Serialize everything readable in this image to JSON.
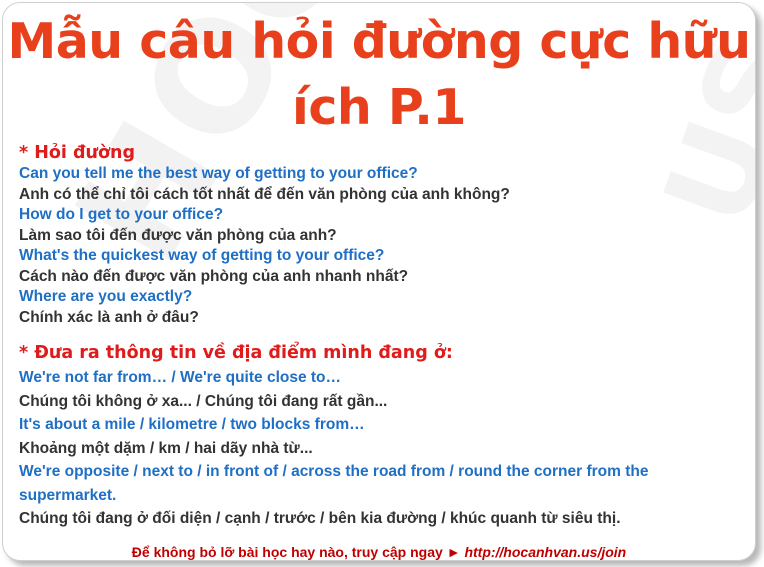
{
  "title": "Mẫu câu hỏi đường cực hữu ích P.1",
  "section1": {
    "heading": "* Hỏi đường",
    "lines": [
      {
        "en": "Can you tell me the best way of getting to your office?",
        "vi": "Anh có thể chỉ tôi cách tốt nhất để đến văn phòng của anh không?"
      },
      {
        "en": "How do I get to your office?",
        "vi": "Làm sao tôi đến được văn phòng của anh?"
      },
      {
        "en": "What's the quickest way of getting to your office?",
        "vi": "Cách nào đến được văn phòng của anh nhanh nhất?"
      },
      {
        "en": "Where are you exactly?",
        "vi": "Chính xác là anh ở đâu?"
      }
    ]
  },
  "section2": {
    "heading": "* Đưa ra thông tin về địa điểm mình đang ở:",
    "lines": [
      {
        "en": "We're not far from… / We're quite close to…",
        "vi": "Chúng tôi không ở xa... / Chúng tôi đang rất gần..."
      },
      {
        "en": "It's about a mile / kilometre / two blocks from…",
        "vi": "Khoảng một dặm / km / hai dãy nhà từ..."
      },
      {
        "en": "We're opposite / next to / in front of / across the road from / round the corner from the supermarket.",
        "vi": "Chúng tôi đang ở đối diện / cạnh / trước / bên kia đường / khúc quanh từ siêu thị."
      }
    ]
  },
  "footer": {
    "text": "Để không bỏ lỡ bài học hay nào, truy cập ngay",
    "arrow": "►",
    "link": "http://hocanhvan.us/join"
  },
  "watermark": {
    "left": "HOCANH",
    "right": "US"
  },
  "colors": {
    "title": "#e8401c",
    "heading": "#e01b1b",
    "english": "#1f6fc5",
    "vietnamese": "#333333",
    "footer": "#c00000"
  }
}
